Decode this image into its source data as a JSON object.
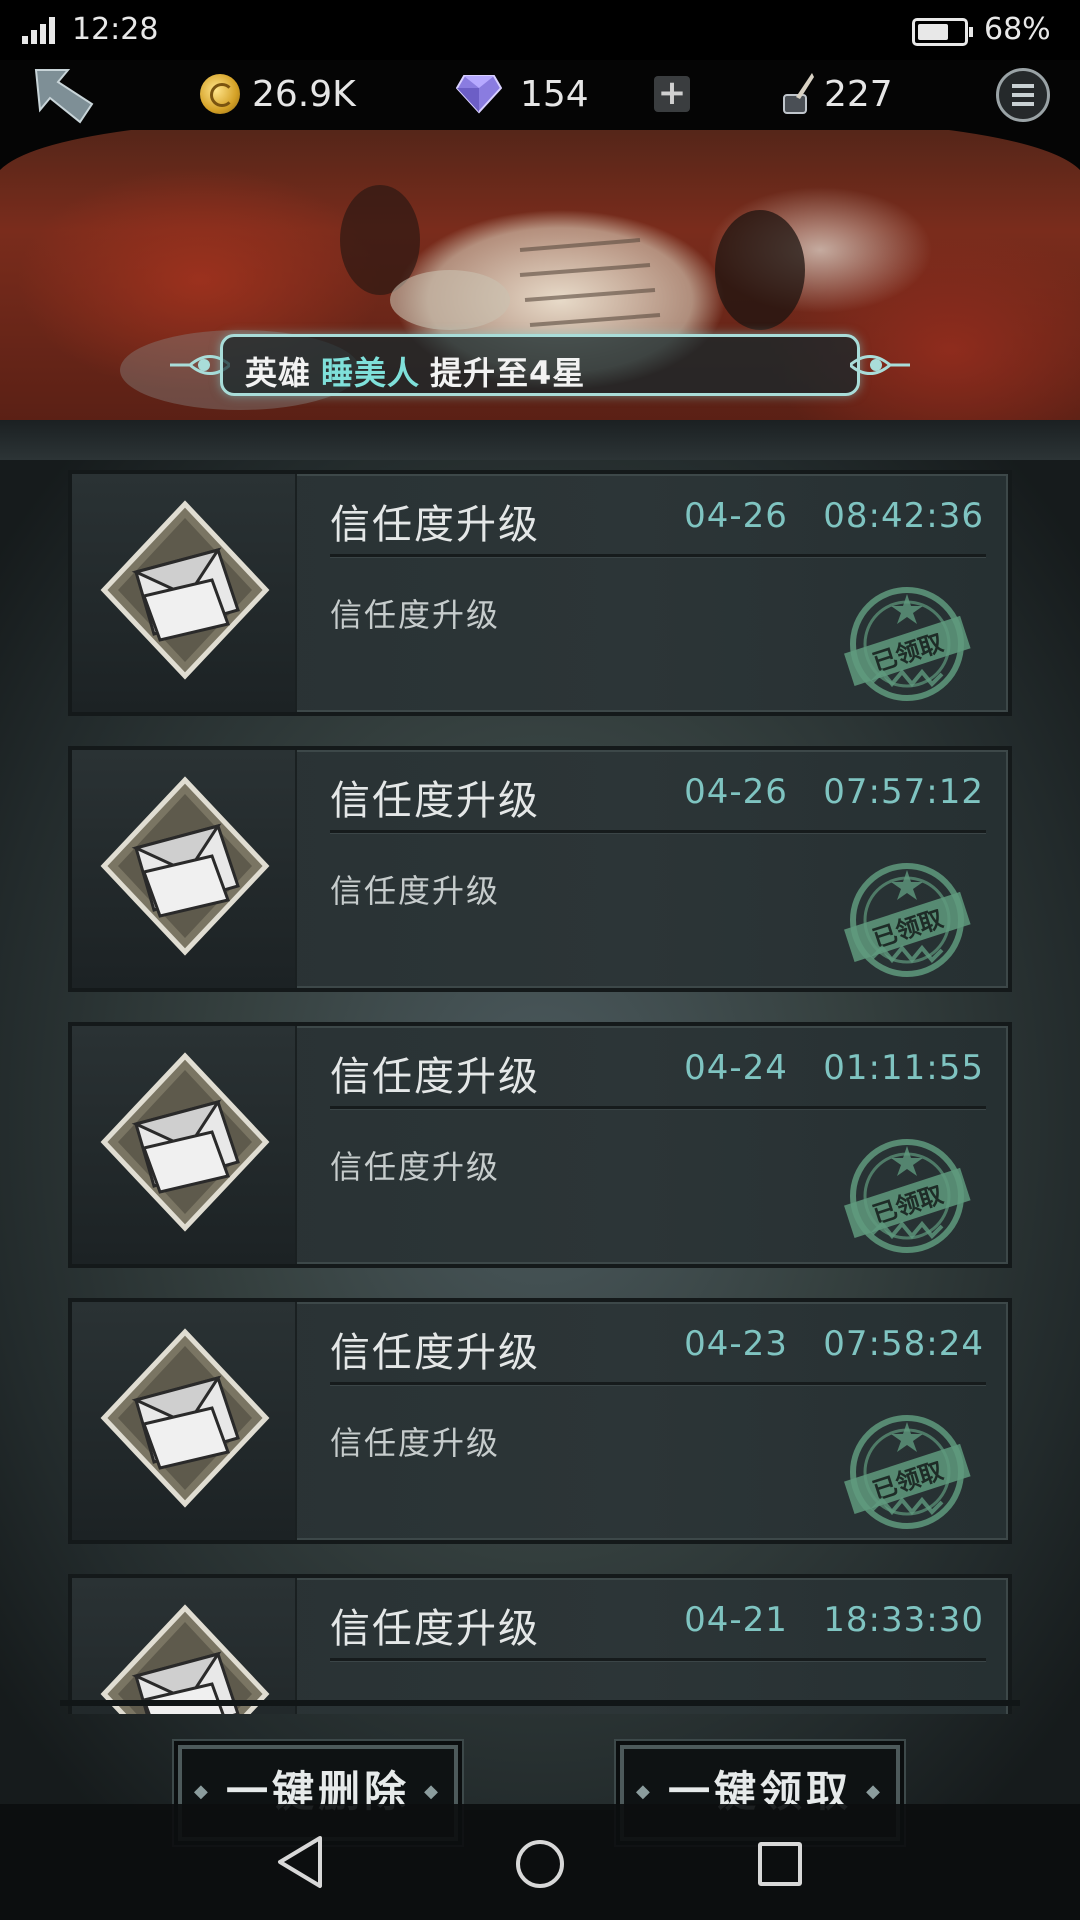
{
  "status_bar": {
    "time": "12:28",
    "battery_percent": "68%",
    "battery_level": 0.68
  },
  "resources": {
    "gold": "26.9K",
    "gems": "154",
    "ink": "227"
  },
  "notice": {
    "prefix": "英雄",
    "hero_name": "睡美人",
    "suffix": "提升至4星"
  },
  "mails": [
    {
      "title": "信任度升级",
      "date": "04-26",
      "time": "08:42:36",
      "body": "信任度升级",
      "stamp": "已领取"
    },
    {
      "title": "信任度升级",
      "date": "04-26",
      "time": "07:57:12",
      "body": "信任度升级",
      "stamp": "已领取"
    },
    {
      "title": "信任度升级",
      "date": "04-24",
      "time": "01:11:55",
      "body": "信任度升级",
      "stamp": "已领取"
    },
    {
      "title": "信任度升级",
      "date": "04-23",
      "time": "07:58:24",
      "body": "信任度升级",
      "stamp": "已领取"
    },
    {
      "title": "信任度升级",
      "date": "04-21",
      "time": "18:33:30",
      "body": "",
      "stamp": ""
    }
  ],
  "actions": {
    "delete_all": "一键删除",
    "claim_all": "一键领取"
  },
  "colors": {
    "accent_teal": "#7fc4c1",
    "stamp_green": "#5f9a7e",
    "hero_highlight": "#7fe0da"
  }
}
